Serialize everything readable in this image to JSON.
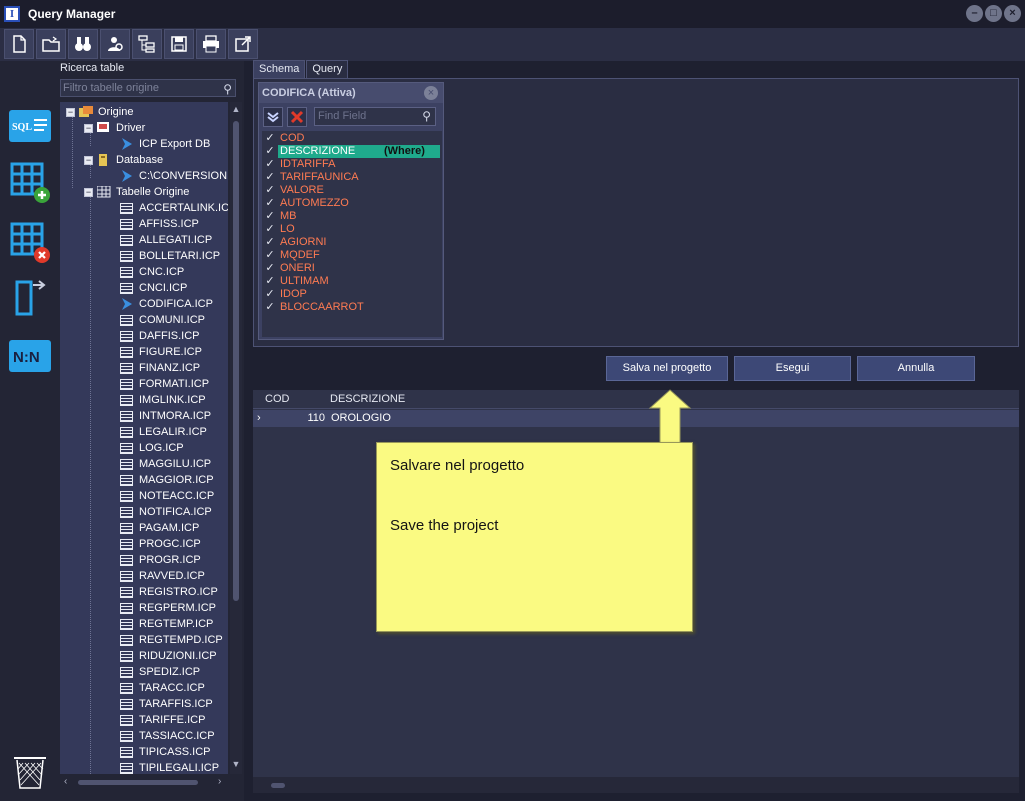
{
  "window": {
    "title": "Query Manager",
    "icon_letter": "I",
    "controls": [
      "–",
      "□",
      "×"
    ]
  },
  "toolbar": {
    "buttons": [
      "new-file-icon",
      "open-folder-icon",
      "binoculars-icon",
      "find-user-icon",
      "tree-view-icon",
      "save-icon",
      "print-icon",
      "export-icon"
    ]
  },
  "leftbar": {
    "sql_label": "SQL",
    "nn_label": "N:N"
  },
  "tree": {
    "label": "Ricerca table",
    "search_placeholder": "Filtro tabelle origine",
    "root": "Origine",
    "driver_label": "Driver",
    "driver_item": "ICP Export DB",
    "database_label": "Database",
    "database_item": "C:\\CONVERSIONI",
    "tables_label": "Tabelle Origine",
    "tables": [
      "ACCERTALINK.ICP",
      "AFFISS.ICP",
      "ALLEGATI.ICP",
      "BOLLETARI.ICP",
      "CNC.ICP",
      "CNCI.ICP",
      "CODIFICA.ICP",
      "COMUNI.ICP",
      "DAFFIS.ICP",
      "FIGURE.ICP",
      "FINANZ.ICP",
      "FORMATI.ICP",
      "IMGLINK.ICP",
      "INTMORA.ICP",
      "LEGALIR.ICP",
      "LOG.ICP",
      "MAGGILU.ICP",
      "MAGGIOR.ICP",
      "NOTEACC.ICP",
      "NOTIFICA.ICP",
      "PAGAM.ICP",
      "PROGC.ICP",
      "PROGR.ICP",
      "RAVVED.ICP",
      "REGISTRO.ICP",
      "REGPERM.ICP",
      "REGTEMP.ICP",
      "REGTEMPD.ICP",
      "RIDUZIONI.ICP",
      "SPEDIZ.ICP",
      "TARACC.ICP",
      "TARAFFIS.ICP",
      "TARIFFE.ICP",
      "TASSIACC.ICP",
      "TIPICASS.ICP",
      "TIPILEGALI.ICP"
    ],
    "selected_table": "CODIFICA.ICP"
  },
  "tabs": [
    "Schema",
    "Query"
  ],
  "table_window": {
    "title": "CODIFICA (Attiva)",
    "find_placeholder": "Find Field",
    "fields": [
      "COD",
      "DESCRIZIONE",
      "IDTARIFFA",
      "TARIFFAUNICA",
      "VALORE",
      "AUTOMEZZO",
      "MB",
      "LO",
      "AGIORNI",
      "MQDEF",
      "ONERI",
      "ULTIMAM",
      "IDOP",
      "BLOCCAARROT"
    ],
    "selected_field": "DESCRIZIONE",
    "where_label": "(Where)"
  },
  "actions": {
    "save": "Salva nel progetto",
    "run": "Esegui",
    "cancel": "Annulla"
  },
  "grid": {
    "columns": [
      "COD",
      "DESCRIZIONE"
    ],
    "rows": [
      {
        "cod": "110",
        "descrizione": "OROLOGIO"
      }
    ],
    "row_marker": "›"
  },
  "callout": {
    "line1": "Salvare nel progetto",
    "line2": "Save the project"
  },
  "colors": {
    "accent": "#1faa8c",
    "field_text": "#ff7b52",
    "callout": "#fafa82",
    "button": "#3d4876"
  }
}
